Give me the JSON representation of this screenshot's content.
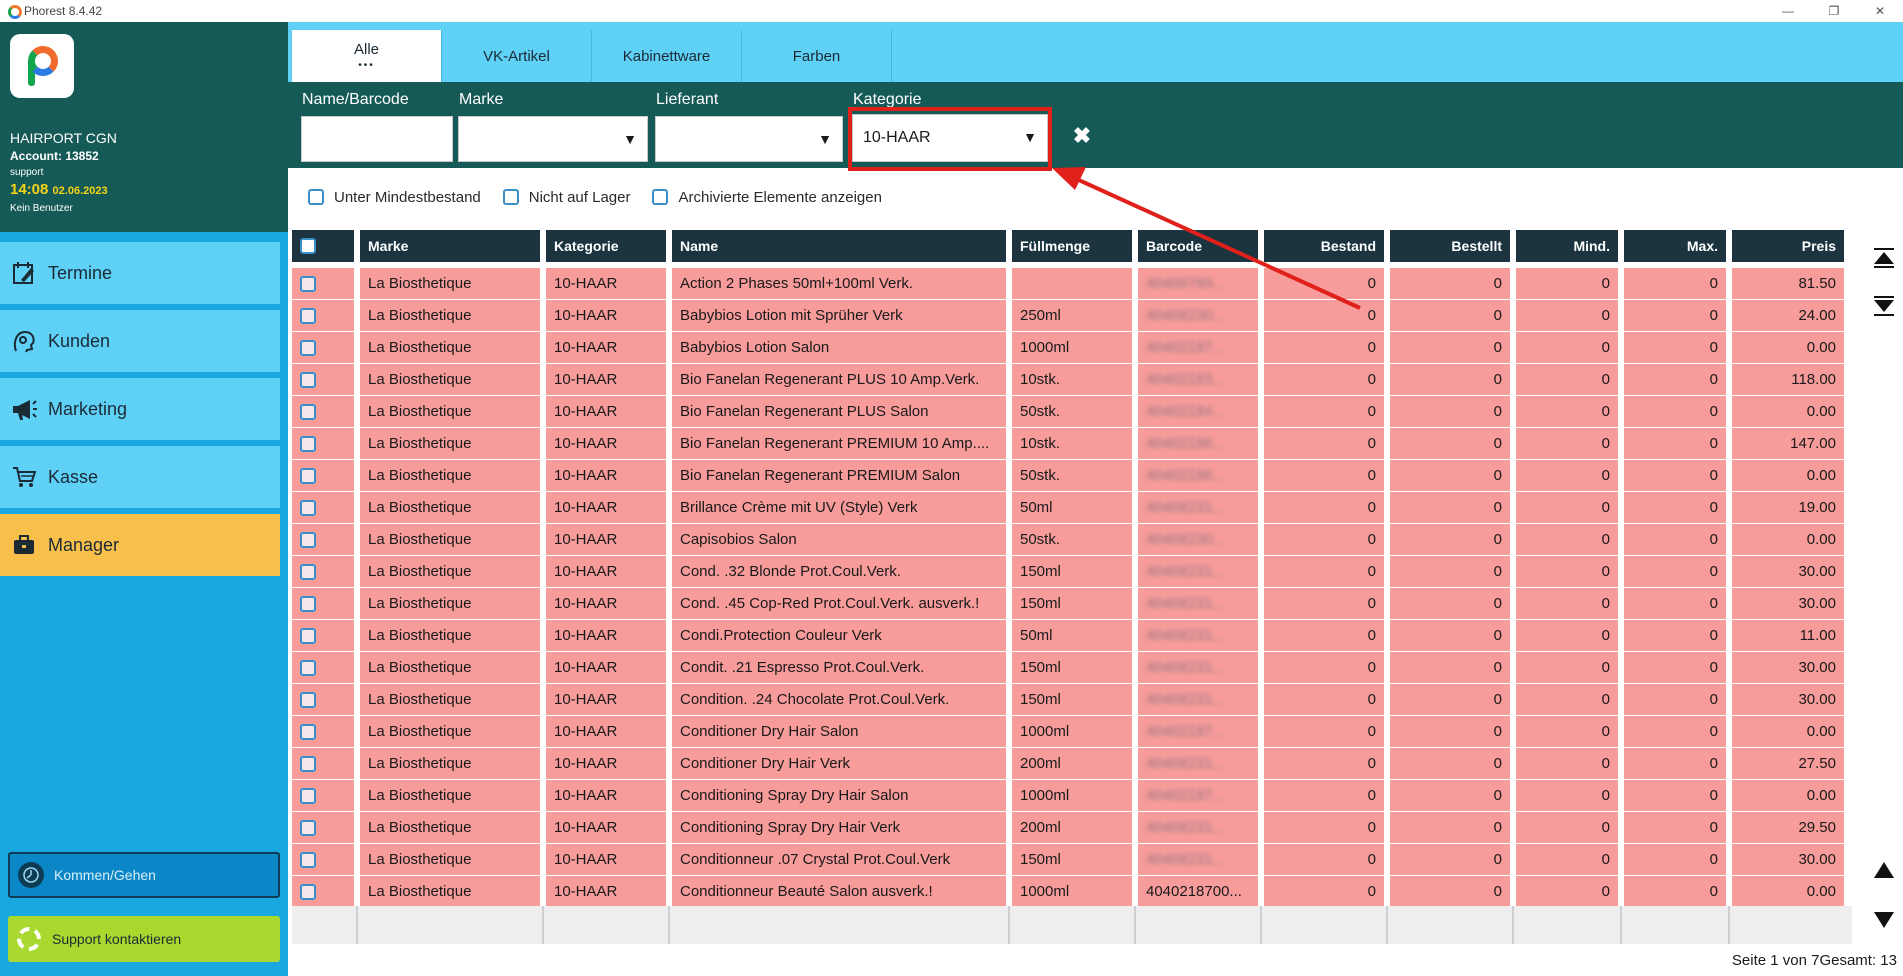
{
  "window": {
    "title": "Phorest 8.4.42",
    "min": "—",
    "max": "❐",
    "close": "✕"
  },
  "account": {
    "salon": "HAIRPORT CGN",
    "account": "Account: 13852",
    "role": "support",
    "time": "14:08",
    "date": "02.06.2023",
    "user": "Kein Benutzer"
  },
  "nav": [
    {
      "label": "Termine",
      "icon": "calendar-edit-icon"
    },
    {
      "label": "Kunden",
      "icon": "customer-head-icon"
    },
    {
      "label": "Marketing",
      "icon": "megaphone-icon"
    },
    {
      "label": "Kasse",
      "icon": "cart-icon"
    },
    {
      "label": "Manager",
      "icon": "briefcase-icon",
      "active": true
    }
  ],
  "sidebar_buttons": {
    "kommen": "Kommen/Gehen",
    "support": "Support kontaktieren"
  },
  "tabs": [
    {
      "label": "Alle",
      "active": true,
      "dots": "•••"
    },
    {
      "label": "VK-Artikel"
    },
    {
      "label": "Kabinettware"
    },
    {
      "label": "Farben"
    }
  ],
  "filters": {
    "name_label": "Name/Barcode",
    "name_value": "",
    "marke_label": "Marke",
    "marke_value": "",
    "lieferant_label": "Lieferant",
    "lieferant_value": "",
    "kategorie_label": "Kategorie",
    "kategorie_value": "10-HAAR",
    "caret": "▼",
    "clear": "✖"
  },
  "options": [
    {
      "label": "Unter Mindestbestand",
      "checked": false
    },
    {
      "label": "Nicht auf Lager",
      "checked": false
    },
    {
      "label": "Archivierte Elemente anzeigen",
      "checked": false
    }
  ],
  "table": {
    "headers": [
      "Marke",
      "Kategorie",
      "Name",
      "Füllmenge",
      "Barcode",
      "Bestand",
      "Bestellt",
      "Mind.",
      "Max.",
      "Preis"
    ],
    "rows": [
      [
        "La Biosthetique",
        "10-HAAR",
        "Action 2 Phases 50ml+100ml Verk.",
        "",
        "40409789...",
        "0",
        "0",
        "0",
        "0",
        "81.50"
      ],
      [
        "La Biosthetique",
        "10-HAAR",
        "Babybios Lotion mit Sprüher Verk",
        "250ml",
        "40408230...",
        "0",
        "0",
        "0",
        "0",
        "24.00"
      ],
      [
        "La Biosthetique",
        "10-HAAR",
        "Babybios Lotion Salon",
        "1000ml",
        "40402187...",
        "0",
        "0",
        "0",
        "0",
        "0.00"
      ],
      [
        "La Biosthetique",
        "10-HAAR",
        "Bio Fanelan Regenerant PLUS 10 Amp.Verk.",
        "10stk.",
        "40402183...",
        "0",
        "0",
        "0",
        "0",
        "118.00"
      ],
      [
        "La Biosthetique",
        "10-HAAR",
        "Bio Fanelan Regenerant PLUS Salon",
        "50stk.",
        "40402184...",
        "0",
        "0",
        "0",
        "0",
        "0.00"
      ],
      [
        "La Biosthetique",
        "10-HAAR",
        "Bio Fanelan Regenerant PREMIUM 10 Amp....",
        "10stk.",
        "40402186...",
        "0",
        "0",
        "0",
        "0",
        "147.00"
      ],
      [
        "La Biosthetique",
        "10-HAAR",
        "Bio Fanelan Regenerant PREMIUM Salon",
        "50stk.",
        "40402186...",
        "0",
        "0",
        "0",
        "0",
        "0.00"
      ],
      [
        "La Biosthetique",
        "10-HAAR",
        "Brillance Crème mit UV (Style) Verk",
        "50ml",
        "40408231...",
        "0",
        "0",
        "0",
        "0",
        "19.00"
      ],
      [
        "La Biosthetique",
        "10-HAAR",
        "Capisobios Salon",
        "50stk.",
        "40408230...",
        "0",
        "0",
        "0",
        "0",
        "0.00"
      ],
      [
        "La Biosthetique",
        "10-HAAR",
        "Cond. .32 Blonde Prot.Coul.Verk.",
        "150ml",
        "40408231...",
        "0",
        "0",
        "0",
        "0",
        "30.00"
      ],
      [
        "La Biosthetique",
        "10-HAAR",
        "Cond. .45 Cop-Red Prot.Coul.Verk. ausverk.!",
        "150ml",
        "40408231...",
        "0",
        "0",
        "0",
        "0",
        "30.00"
      ],
      [
        "La Biosthetique",
        "10-HAAR",
        "Condi.Protection Couleur Verk",
        "50ml",
        "40408231...",
        "0",
        "0",
        "0",
        "0",
        "11.00"
      ],
      [
        "La Biosthetique",
        "10-HAAR",
        "Condit. .21 Espresso Prot.Coul.Verk.",
        "150ml",
        "40408231...",
        "0",
        "0",
        "0",
        "0",
        "30.00"
      ],
      [
        "La Biosthetique",
        "10-HAAR",
        "Condition. .24 Chocolate Prot.Coul.Verk.",
        "150ml",
        "40408231...",
        "0",
        "0",
        "0",
        "0",
        "30.00"
      ],
      [
        "La Biosthetique",
        "10-HAAR",
        "Conditioner Dry Hair Salon",
        "1000ml",
        "40402187...",
        "0",
        "0",
        "0",
        "0",
        "0.00"
      ],
      [
        "La Biosthetique",
        "10-HAAR",
        "Conditioner Dry Hair Verk",
        "200ml",
        "40408231...",
        "0",
        "0",
        "0",
        "0",
        "27.50"
      ],
      [
        "La Biosthetique",
        "10-HAAR",
        "Conditioning Spray Dry Hair Salon",
        "1000ml",
        "40402187...",
        "0",
        "0",
        "0",
        "0",
        "0.00"
      ],
      [
        "La Biosthetique",
        "10-HAAR",
        "Conditioning Spray Dry Hair Verk",
        "200ml",
        "40408231...",
        "0",
        "0",
        "0",
        "0",
        "29.50"
      ],
      [
        "La Biosthetique",
        "10-HAAR",
        "Conditionneur .07 Crystal Prot.Coul.Verk",
        "150ml",
        "40408231...",
        "0",
        "0",
        "0",
        "0",
        "30.00"
      ],
      [
        "La Biosthetique",
        "10-HAAR",
        "Conditionneur Beauté Salon ausverk.!",
        "1000ml",
        "4040218700...",
        "0",
        "0",
        "0",
        "0",
        "0.00"
      ]
    ]
  },
  "pager": "Seite 1 von 7Gesamt: 13",
  "colors": {
    "sidebar": "#1aa8e0",
    "header_dark": "#165a57",
    "row_pink": "#f79b9b",
    "active_nav": "#f8c04b",
    "highlight": "#e0201a"
  }
}
